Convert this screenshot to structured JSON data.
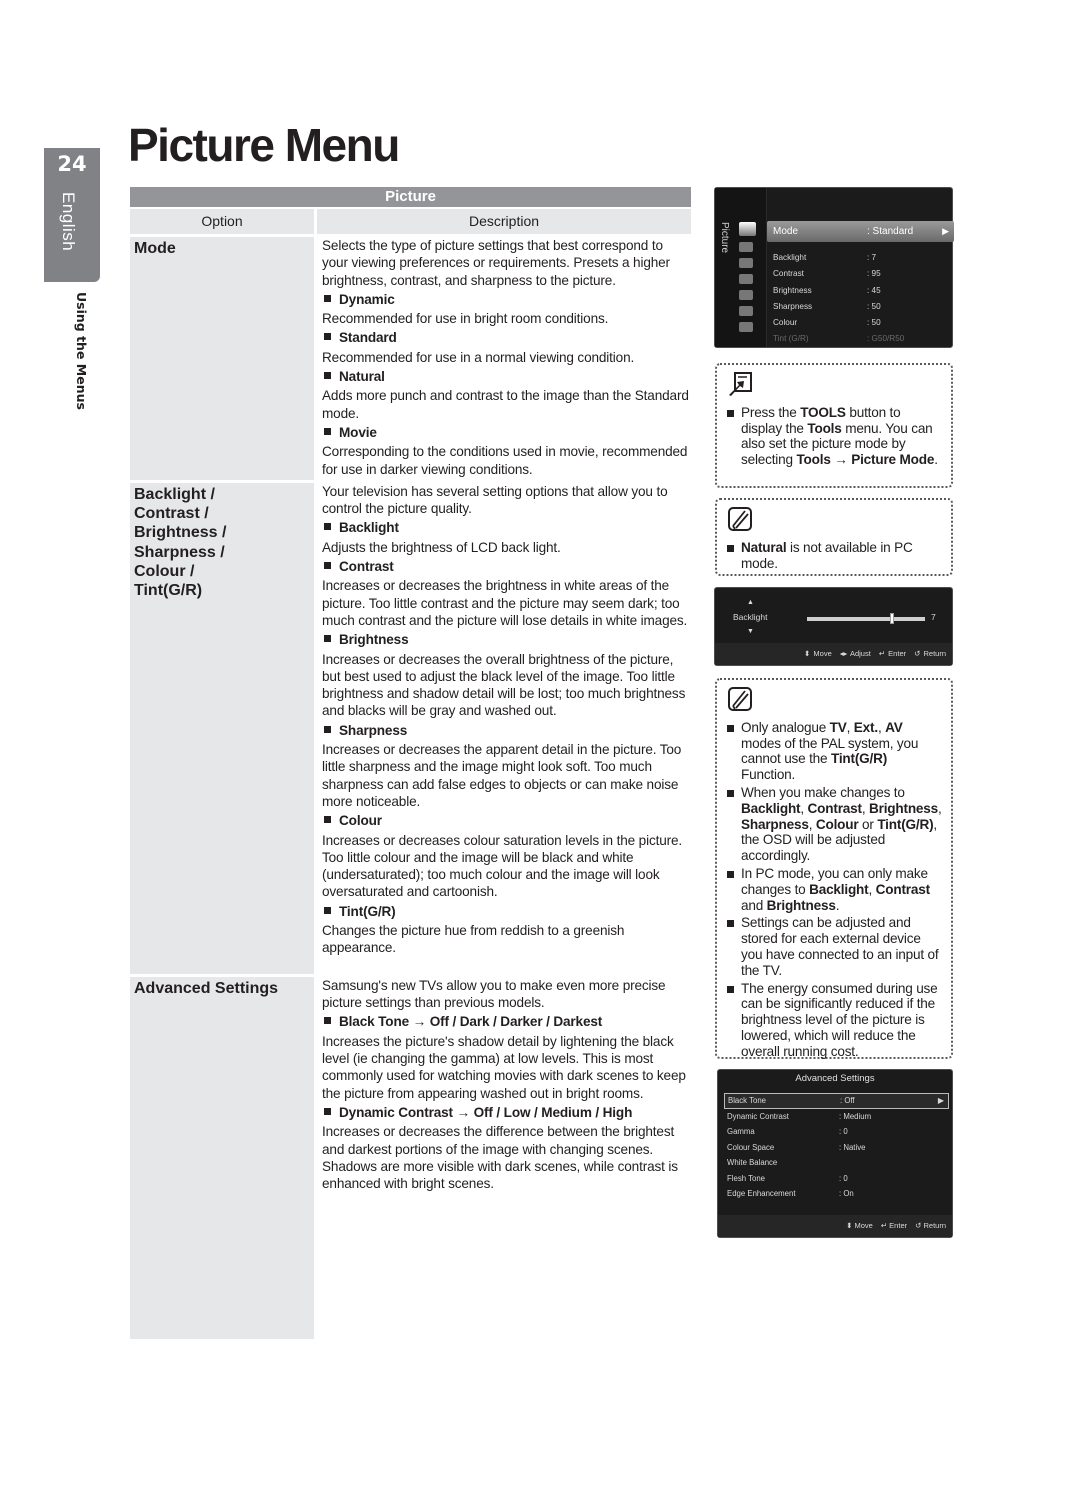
{
  "page": {
    "number": "24",
    "language": "English",
    "section": "Using the Menus",
    "title": "Picture Menu"
  },
  "table": {
    "caption": "Picture",
    "col_option": "Option",
    "col_description": "Description",
    "rows": [
      {
        "option_lines": [
          "Mode"
        ],
        "intro": "Selects the type of picture settings that best correspond to your viewing preferences or requirements. Presets a higher brightness, contrast, and sharpness to the picture.",
        "items": [
          {
            "head": "Dynamic",
            "text": "Recommended for use in bright room conditions."
          },
          {
            "head": "Standard",
            "text": "Recommended for use in a normal viewing condition."
          },
          {
            "head": "Natural",
            "text": "Adds more punch and contrast to the image than the Standard mode."
          },
          {
            "head": "Movie",
            "text": "Corresponding to the conditions used in movie, recommended for use in darker viewing conditions."
          }
        ]
      },
      {
        "option_lines": [
          "Backlight /",
          "Contrast /",
          "Brightness /",
          "Sharpness /",
          "Colour /",
          "Tint(G/R)"
        ],
        "intro": "Your television has several setting options that allow you to control the picture quality.",
        "items": [
          {
            "head": "Backlight",
            "text": "Adjusts the brightness of LCD back light."
          },
          {
            "head": "Contrast",
            "text": "Increases or decreases the brightness in white areas of the picture. Too little contrast and the picture may seem dark; too much contrast and the picture will lose details in white images."
          },
          {
            "head": "Brightness",
            "text": "Increases or decreases the overall brightness of the picture, but best used to adjust the black level of the image. Too little brightness and shadow detail will be lost; too much brightness and blacks will be gray and washed out."
          },
          {
            "head": "Sharpness",
            "text": "Increases or decreases the apparent detail in the picture. Too little sharpness and the image might look soft. Too much sharpness can add false edges to objects or can make noise more noticeable."
          },
          {
            "head": "Colour",
            "text": "Increases or decreases colour saturation levels in the picture. Too little colour and the image will be black and white (undersaturated); too much colour and the image will look oversaturated and cartoonish."
          },
          {
            "head": "Tint(G/R)",
            "text": "Changes the picture hue from reddish to a greenish appearance."
          }
        ]
      },
      {
        "option_lines": [
          "Advanced Settings"
        ],
        "intro": "Samsung's new TVs allow you to make even more precise picture settings than previous models.",
        "items": [
          {
            "head": "Black Tone → Off / Dark / Darker / Darkest",
            "text": "Increases the picture's shadow detail by lightening the black level (ie changing the gamma) at low levels. This is most commonly used for watching movies with dark scenes to keep the picture from appearing washed out in bright rooms."
          },
          {
            "head": "Dynamic Contrast → Off / Low / Medium / High",
            "text": "Increases or decreases the difference between the brightest and darkest portions of the image with changing scenes. Shadows are more visible with dark scenes, while contrast is enhanced with bright scenes."
          }
        ]
      }
    ]
  },
  "osd_picture": {
    "side_title": "Picture",
    "selected": {
      "label": "Mode",
      "value": ": Standard"
    },
    "items": [
      {
        "label": "Backlight",
        "value": ": 7",
        "dim": false
      },
      {
        "label": "Contrast",
        "value": ": 95",
        "dim": false
      },
      {
        "label": "Brightness",
        "value": ": 45",
        "dim": false
      },
      {
        "label": "Sharpness",
        "value": ": 50",
        "dim": false
      },
      {
        "label": "Colour",
        "value": ": 50",
        "dim": false
      },
      {
        "label": "Tint (G/R)",
        "value": ": G50/R50",
        "dim": true
      }
    ]
  },
  "osd_backlight": {
    "label": "Backlight",
    "value": "7",
    "level_fraction": 0.7,
    "footer": [
      "⬍ Move",
      "◂▸ Adjust",
      "↵ Enter",
      "↺ Return"
    ]
  },
  "osd_advanced": {
    "title": "Advanced Settings",
    "items": [
      {
        "label": "Black Tone",
        "value": ": Off",
        "selected": true
      },
      {
        "label": "Dynamic Contrast",
        "value": ": Medium"
      },
      {
        "label": "Gamma",
        "value": ": 0"
      },
      {
        "label": "Colour Space",
        "value": ": Native"
      },
      {
        "label": "White Balance",
        "value": ""
      },
      {
        "label": "Flesh Tone",
        "value": ": 0"
      },
      {
        "label": "Edge Enhancement",
        "value": ": On"
      }
    ],
    "footer": [
      "⬍ Move",
      "↵ Enter",
      "↺ Return"
    ]
  },
  "notes": {
    "tools": {
      "icon": "tools-icon",
      "segments": [
        {
          "t": "Press the ",
          "b": false
        },
        {
          "t": "TOOLS",
          "b": true
        },
        {
          "t": " button to display the ",
          "b": false
        },
        {
          "t": "Tools",
          "b": true
        },
        {
          "t": " menu. You can also set the picture mode by selecting ",
          "b": false
        },
        {
          "t": "Tools → Picture Mode",
          "b": true
        },
        {
          "t": ".",
          "b": false
        }
      ]
    },
    "natural": {
      "icon": "note-icon",
      "segments": [
        {
          "t": "Natural",
          "b": true
        },
        {
          "t": " is not available in PC mode.",
          "b": false
        }
      ]
    },
    "main": {
      "icon": "note-icon",
      "bullets": [
        [
          {
            "t": "Only analogue ",
            "b": false
          },
          {
            "t": "TV",
            "b": true
          },
          {
            "t": ", ",
            "b": false
          },
          {
            "t": "Ext.",
            "b": true
          },
          {
            "t": ", ",
            "b": false
          },
          {
            "t": "AV",
            "b": true
          },
          {
            "t": " modes of the PAL system, you cannot use the ",
            "b": false
          },
          {
            "t": "Tint(G/R)",
            "b": true
          },
          {
            "t": " Function.",
            "b": false
          }
        ],
        [
          {
            "t": "When you make changes to ",
            "b": false
          },
          {
            "t": "Backlight",
            "b": true
          },
          {
            "t": ", ",
            "b": false
          },
          {
            "t": "Contrast",
            "b": true
          },
          {
            "t": ", ",
            "b": false
          },
          {
            "t": "Brightness",
            "b": true
          },
          {
            "t": ", ",
            "b": false
          },
          {
            "t": "Sharpness",
            "b": true
          },
          {
            "t": ", ",
            "b": false
          },
          {
            "t": "Colour",
            "b": true
          },
          {
            "t": " or ",
            "b": false
          },
          {
            "t": "Tint(G/R)",
            "b": true
          },
          {
            "t": ", the OSD will be adjusted accordingly.",
            "b": false
          }
        ],
        [
          {
            "t": "In PC mode, you can only make changes to ",
            "b": false
          },
          {
            "t": "Backlight",
            "b": true
          },
          {
            "t": ", ",
            "b": false
          },
          {
            "t": "Contrast",
            "b": true
          },
          {
            "t": " and ",
            "b": false
          },
          {
            "t": "Brightness",
            "b": true
          },
          {
            "t": ".",
            "b": false
          }
        ],
        [
          {
            "t": "Settings can be adjusted and stored for each external device you have connected to an input of the TV.",
            "b": false
          }
        ],
        [
          {
            "t": "The energy consumed during use can be significantly reduced if the brightness level of the picture is lowered, which will reduce the overall running cost.",
            "b": false
          }
        ]
      ]
    }
  }
}
